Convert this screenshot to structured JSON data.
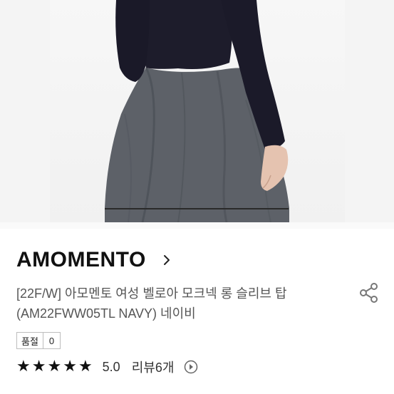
{
  "product": {
    "brand": "AMOMENTO",
    "title_line1": "[22F/W] 아모멘토 여성 벨로아 모크넥 롱 슬리브 탑",
    "title_line2": "(AM22FWW05TL NAVY) 네이비",
    "condition_label": "품절",
    "condition_value": "0",
    "rating": "5.0",
    "reviews": "리뷰6개",
    "stars_filled": 5
  },
  "icons": {
    "brand_chevron": "chevron-right-icon",
    "share": "share-icon",
    "reviews_more": "play-circle-icon",
    "star": "star-icon"
  },
  "colors": {
    "top_navy": "#1d1c2b",
    "skirt_gray": "#5d6168",
    "text_primary": "#111111",
    "text_secondary": "#555555"
  }
}
